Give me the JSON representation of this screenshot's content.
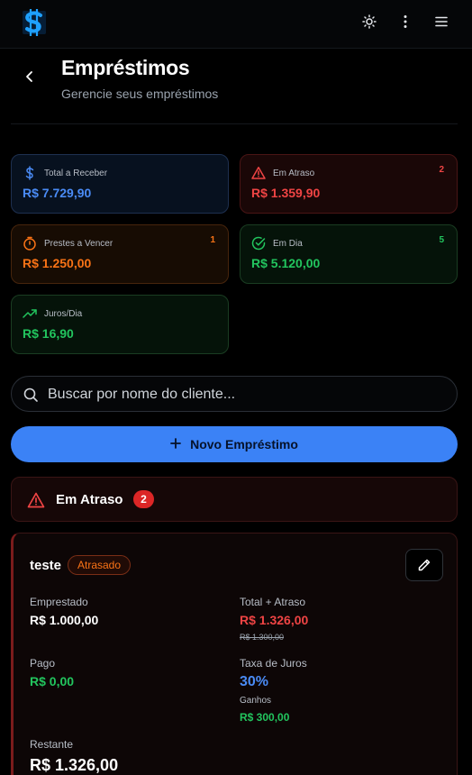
{
  "header": {
    "logo_icon": "dollar-logo-icon",
    "theme_icon": "sun-icon",
    "more_icon": "vertical-dots-icon",
    "menu_icon": "hamburger-icon"
  },
  "page": {
    "title": "Empréstimos",
    "subtitle": "Gerencie seus empréstimos"
  },
  "stats": {
    "total": {
      "label": "Total a Receber",
      "value": "R$ 7.729,90",
      "icon": "dollar-icon"
    },
    "overdue": {
      "label": "Em Atraso",
      "value": "R$ 1.359,90",
      "count": "2",
      "icon": "alert-triangle-icon"
    },
    "due_soon": {
      "label": "Prestes a Vencer",
      "value": "R$ 1.250,00",
      "count": "1",
      "icon": "timer-icon"
    },
    "on_time": {
      "label": "Em Dia",
      "value": "R$ 5.120,00",
      "count": "5",
      "icon": "check-circle-icon"
    },
    "interest": {
      "label": "Juros/Dia",
      "value": "R$ 16,90",
      "icon": "trending-up-icon"
    }
  },
  "search": {
    "placeholder": "Buscar por nome do cliente..."
  },
  "new_loan_button": {
    "label": "Novo Empréstimo",
    "icon": "plus-icon"
  },
  "overdue_section": {
    "title": "Em Atraso",
    "count": "2",
    "icon": "alert-triangle-icon"
  },
  "loan": {
    "name": "teste",
    "status": "Atrasado",
    "lent_label": "Emprestado",
    "lent_value": "R$ 1.000,00",
    "total_label": "Total + Atraso",
    "total_value": "R$ 1.326,00",
    "total_original": "R$ 1.300,00",
    "paid_label": "Pago",
    "paid_value": "R$ 0,00",
    "rate_label": "Taxa de Juros",
    "rate_value": "30%",
    "earnings_label": "Ganhos",
    "earnings_value": "R$ 300,00",
    "remaining_label": "Restante",
    "remaining_value": "R$ 1.326,00"
  },
  "colors": {
    "blue": "#4a8bf5",
    "red": "#ef4444",
    "orange": "#f97316",
    "green": "#22c55e"
  }
}
